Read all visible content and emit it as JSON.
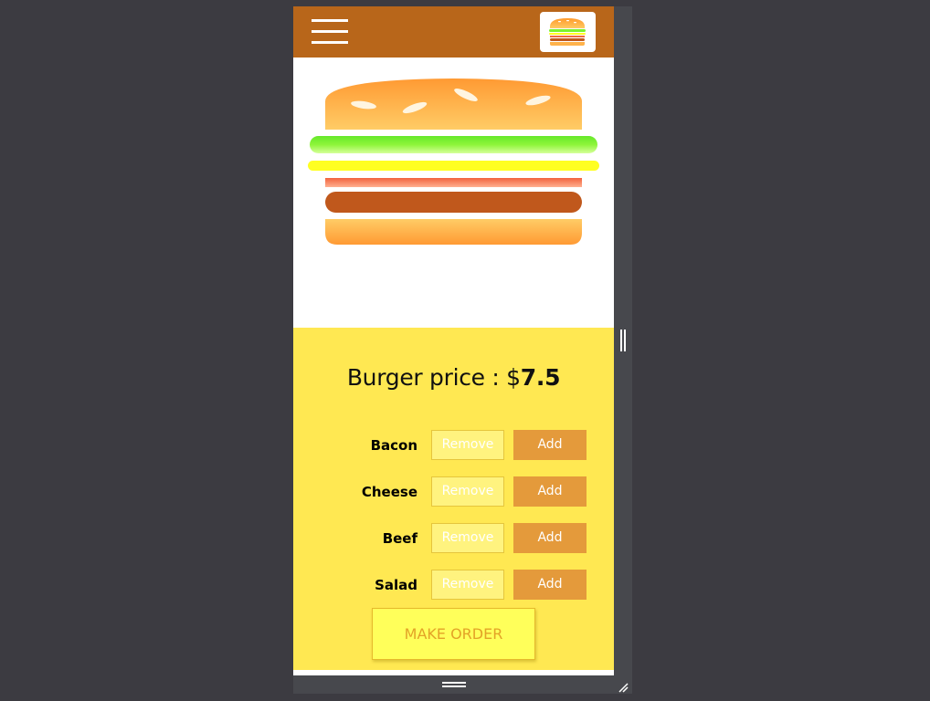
{
  "header": {
    "menu_icon": "hamburger-menu-icon",
    "logo_icon": "burger-logo-icon"
  },
  "burger": {
    "bun_color": "#ffa03a",
    "salad_color": "#7bf22d",
    "cheese_color": "#ffff22",
    "bacon_color": "#ef6a3f",
    "beef_color": "#c0581c"
  },
  "price": {
    "label": "Burger price : $",
    "value": "7.5"
  },
  "ingredients": [
    {
      "label": "Bacon",
      "remove": "Remove",
      "add": "Add"
    },
    {
      "label": "Cheese",
      "remove": "Remove",
      "add": "Add"
    },
    {
      "label": "Beef",
      "remove": "Remove",
      "add": "Add"
    },
    {
      "label": "Salad",
      "remove": "Remove",
      "add": "Add"
    }
  ],
  "order_button": "MAKE ORDER",
  "colors": {
    "toolbar": "#b8661a",
    "panel": "#ffe852",
    "add_button": "#e49a3b",
    "order_text": "#e3a227"
  }
}
